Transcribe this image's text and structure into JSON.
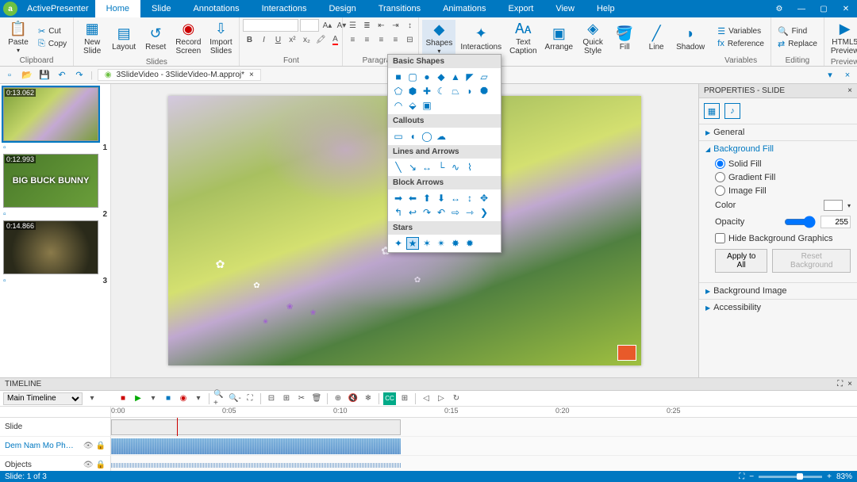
{
  "app": {
    "name": "ActivePresenter"
  },
  "menu": {
    "tabs": [
      "Home",
      "Slide",
      "Annotations",
      "Interactions",
      "Design",
      "Transitions",
      "Animations",
      "Export",
      "View",
      "Help"
    ],
    "active": "Home"
  },
  "ribbon": {
    "clipboard": {
      "paste": "Paste",
      "cut": "Cut",
      "copy": "Copy",
      "label": "Clipboard"
    },
    "slides": {
      "new": "New\nSlide",
      "layout": "Layout",
      "reset": "Reset",
      "record": "Record\nScreen",
      "import": "Import\nSlides",
      "label": "Slides"
    },
    "font": {
      "label": "Font"
    },
    "paragraph": {
      "label": "Paragraph"
    },
    "annotations": {
      "shapes": "Shapes",
      "interactions": "Interactions",
      "textcaption": "Text\nCaption",
      "arrange": "Arrange",
      "quickstyle": "Quick\nStyle",
      "fill": "Fill",
      "line": "Line",
      "shadow": "Shadow"
    },
    "variables": {
      "variables": "Variables",
      "reference": "Reference",
      "label": "Variables"
    },
    "editing": {
      "find": "Find",
      "replace": "Replace",
      "label": "Editing"
    },
    "preview": {
      "html5": "HTML5\nPreview",
      "label": "Preview"
    }
  },
  "document": {
    "title": "3SlideVideo - 3SlideVideo-M.approj*"
  },
  "slides": [
    {
      "time": "0:13.062",
      "num": "1",
      "type": "nature",
      "selected": true
    },
    {
      "time": "0:12.993",
      "num": "2",
      "type": "bunny",
      "title": "BIG BUCK BUNNY"
    },
    {
      "time": "0:14.866",
      "num": "3",
      "type": "dark"
    }
  ],
  "shapes_menu": {
    "basic": "Basic Shapes",
    "callouts": "Callouts",
    "lines": "Lines and Arrows",
    "arrows": "Block Arrows",
    "stars": "Stars"
  },
  "properties": {
    "title": "PROPERTIES - SLIDE",
    "sections": {
      "general": "General",
      "bgfill": "Background Fill",
      "bgimage": "Background Image",
      "access": "Accessibility"
    },
    "fill": {
      "solid": "Solid Fill",
      "gradient": "Gradient Fill",
      "image": "Image Fill",
      "color": "Color",
      "opacity": "Opacity",
      "opacity_val": "255",
      "hide_graphics": "Hide Background Graphics",
      "apply_all": "Apply to All",
      "reset": "Reset Background"
    }
  },
  "timeline": {
    "title": "TIMELINE",
    "main": "Main Timeline",
    "slide_track": "Slide",
    "audio_track": "Dem Nam Mo Pho - Th...",
    "objects_track": "Objects",
    "ruler": [
      "0:00",
      "0:05",
      "0:10",
      "0:15",
      "0:20",
      "0:25"
    ]
  },
  "status": {
    "slide_info": "Slide: 1 of 3",
    "zoom": "83%"
  }
}
